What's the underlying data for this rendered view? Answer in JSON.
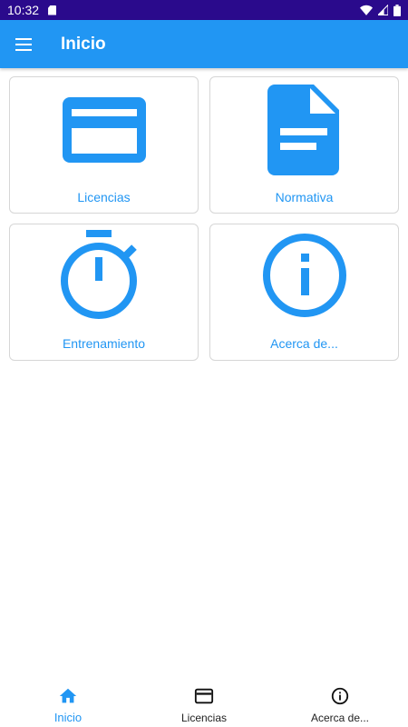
{
  "status_bar": {
    "time": "10:32"
  },
  "app_bar": {
    "title": "Inicio"
  },
  "tiles": [
    {
      "label": "Licencias",
      "icon": "card-icon"
    },
    {
      "label": "Normativa",
      "icon": "document-icon"
    },
    {
      "label": "Entrenamiento",
      "icon": "stopwatch-icon"
    },
    {
      "label": "Acerca de...",
      "icon": "info-icon"
    }
  ],
  "bottom_nav": [
    {
      "label": "Inicio",
      "icon": "home-icon",
      "active": true
    },
    {
      "label": "Licencias",
      "icon": "card-icon",
      "active": false
    },
    {
      "label": "Acerca de...",
      "icon": "info-icon",
      "active": false
    }
  ],
  "colors": {
    "primary": "#2196f3",
    "status_bar": "#2a0a8c",
    "text_dark": "#222222"
  }
}
